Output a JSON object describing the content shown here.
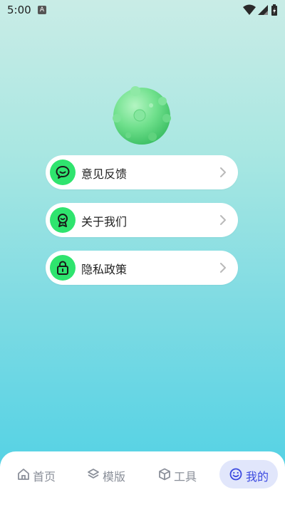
{
  "status_bar": {
    "time": "5:00",
    "notification_badge": "A",
    "icons": [
      "wifi-icon",
      "signal-icon",
      "battery-icon"
    ]
  },
  "menu": {
    "items": [
      {
        "label": "意见反馈",
        "icon": "chat-bubble-icon"
      },
      {
        "label": "关于我们",
        "icon": "award-badge-icon"
      },
      {
        "label": "隐私政策",
        "icon": "lock-icon"
      }
    ]
  },
  "bottom_nav": {
    "tabs": [
      {
        "label": "首页",
        "icon": "home-icon",
        "active": false
      },
      {
        "label": "模版",
        "icon": "layers-icon",
        "active": false
      },
      {
        "label": "工具",
        "icon": "cube-icon",
        "active": false
      },
      {
        "label": "我的",
        "icon": "smiley-icon",
        "active": true
      }
    ]
  },
  "colors": {
    "accent": "#2fe46e",
    "nav_active": "#3c4ae0",
    "nav_active_bg": "#e1e6fb",
    "nav_inactive": "#8a8f99"
  }
}
